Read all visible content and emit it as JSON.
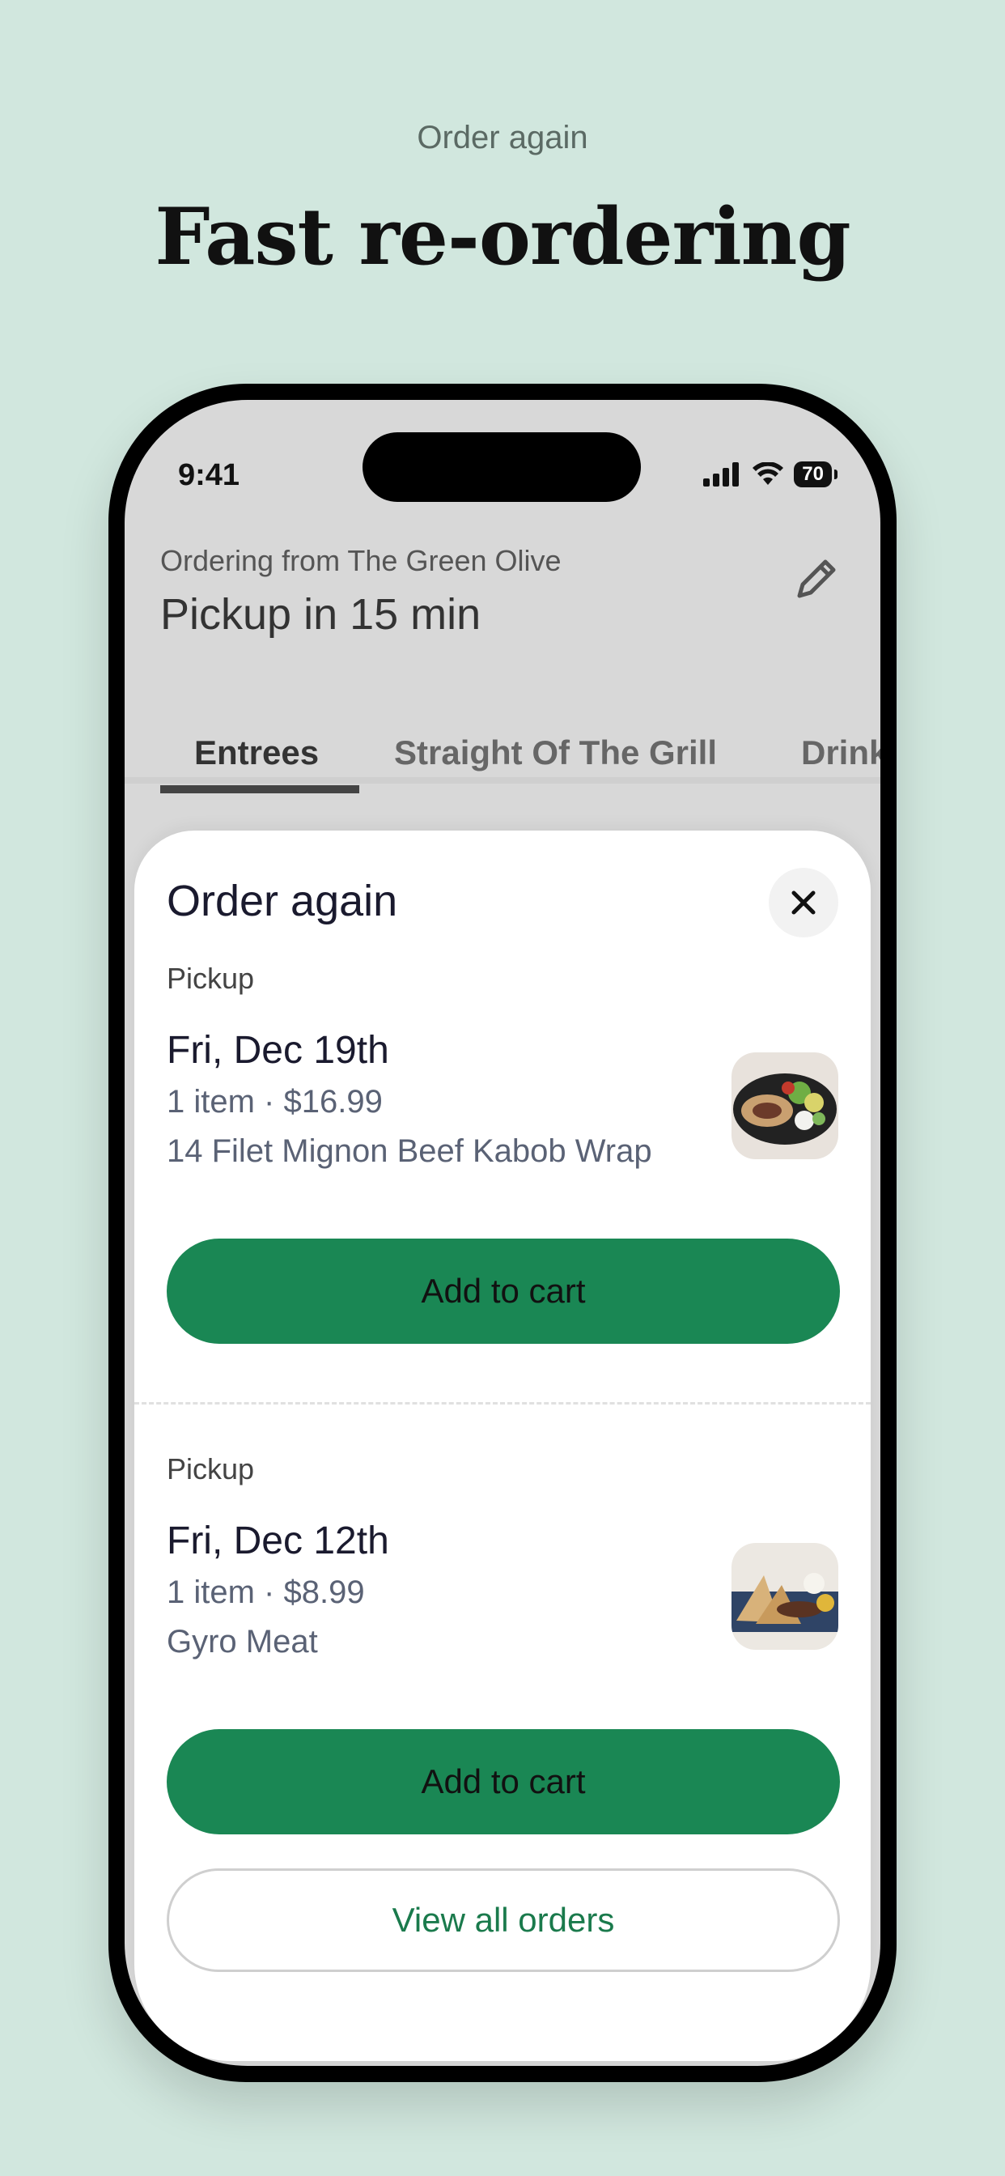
{
  "marketing": {
    "eyebrow": "Order again",
    "headline": "Fast re-ordering"
  },
  "status_bar": {
    "time": "9:41",
    "battery": "70"
  },
  "header": {
    "ordering_from": "Ordering from The Green Olive",
    "pickup_time": "Pickup in 15 min"
  },
  "tabs": [
    {
      "label": "Entrees",
      "active": true
    },
    {
      "label": "Straight Of The Grill",
      "active": false
    },
    {
      "label": "Drinks",
      "active": false
    }
  ],
  "sheet": {
    "title": "Order again",
    "orders": [
      {
        "type": "Pickup",
        "date": "Fri, Dec 19th",
        "meta": "1 item · $16.99",
        "item": "14 Filet Mignon Beef Kabob Wrap",
        "add_label": "Add to cart",
        "thumb_icon": "beef-kabob-wrap-photo"
      },
      {
        "type": "Pickup",
        "date": "Fri, Dec 12th",
        "meta": "1 item · $8.99",
        "item": "Gyro Meat",
        "add_label": "Add to cart",
        "thumb_icon": "gyro-meat-photo"
      }
    ],
    "view_all_label": "View all orders"
  },
  "colors": {
    "background": "#d1e7de",
    "primary_button": "#1a8754",
    "link_green": "#1a7a4c"
  }
}
